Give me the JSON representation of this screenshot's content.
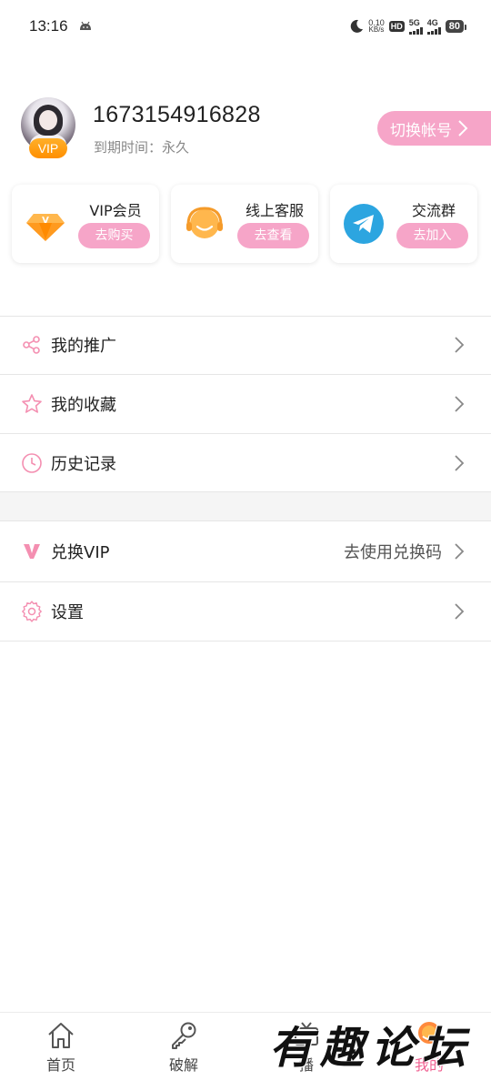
{
  "status_bar": {
    "time": "13:16",
    "speed_value": "0.10",
    "speed_unit": "KB/s",
    "hd_label": "HD",
    "net1": "5G",
    "net2": "4G",
    "battery": "80"
  },
  "profile": {
    "vip_badge": "VIP",
    "username": "1673154916828",
    "expiry": "到期时间：永久",
    "switch_account": "切换帐号"
  },
  "cards": [
    {
      "title": "VIP会员",
      "button": "去购买",
      "icon": "diamond-icon"
    },
    {
      "title": "线上客服",
      "button": "去查看",
      "icon": "customer-service-icon"
    },
    {
      "title": "交流群",
      "button": "去加入",
      "icon": "telegram-icon"
    }
  ],
  "menu": {
    "promotion": "我的推广",
    "favorites": "我的收藏",
    "history": "历史记录",
    "redeem_vip": "兑换VIP",
    "redeem_hint": "去使用兑换码",
    "settings": "设置"
  },
  "bottom_nav": {
    "home": "首页",
    "crack": "破解",
    "live": "播",
    "mine": "我的"
  },
  "watermark": "有趣论坛",
  "colors": {
    "accent_pink": "#f6a5c8",
    "icon_pink": "#f06292",
    "vip_orange": "#ff9800",
    "telegram_blue": "#2ca5e0"
  }
}
